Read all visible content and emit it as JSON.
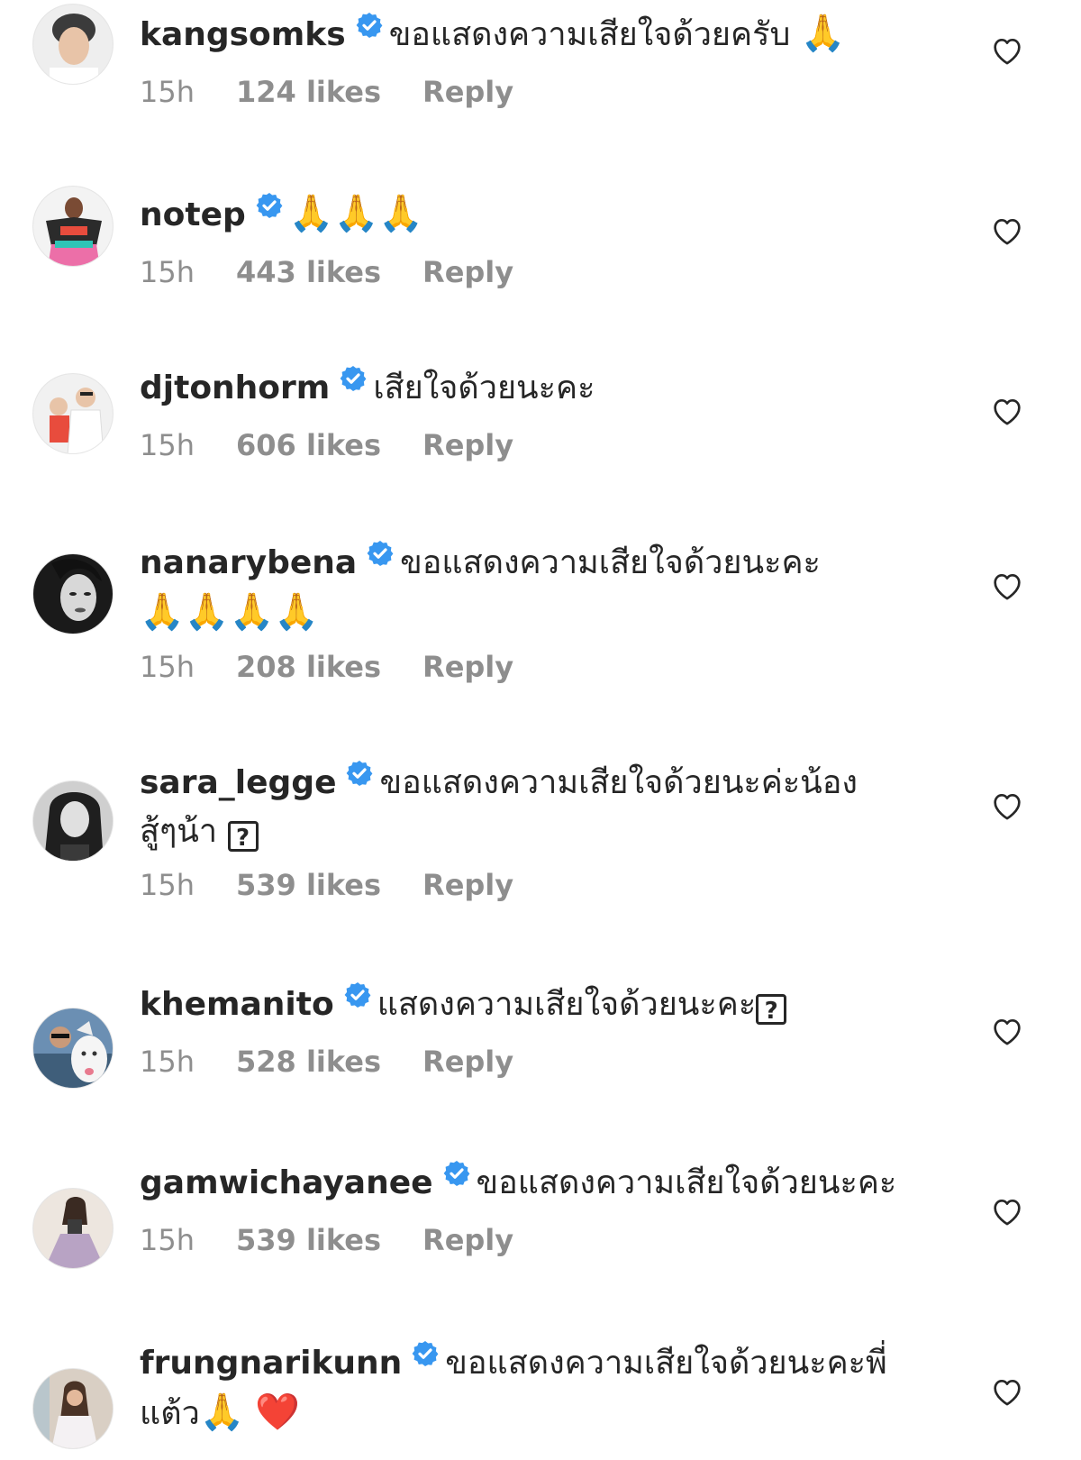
{
  "comments": [
    {
      "username": "kangsomks",
      "text": "ขอแสดงความเสียใจด้วยครับ",
      "emoji": "🙏",
      "time": "15h",
      "likes": "124 likes",
      "reply": "Reply"
    },
    {
      "username": "notep",
      "text": "",
      "emoji": "🙏🙏🙏",
      "time": "15h",
      "likes": "443 likes",
      "reply": "Reply"
    },
    {
      "username": "djtonhorm",
      "text": "เสียใจด้วยนะคะ",
      "time": "15h",
      "likes": "606 likes",
      "reply": "Reply"
    },
    {
      "username": "nanarybena",
      "text": "ขอแสดงความเสียใจด้วยนะคะ",
      "emoji": "🙏🙏🙏🙏",
      "time": "15h",
      "likes": "208 likes",
      "reply": "Reply"
    },
    {
      "username": "sara_legge",
      "text": "ขอแสดงความเสียใจด้วยนะค่ะน้อง",
      "text2": "สู้ๆน้า",
      "glyph": "?",
      "time": "15h",
      "likes": "539 likes",
      "reply": "Reply"
    },
    {
      "username": "khemanito",
      "text": "แสดงความเสียใจด้วยนะคะ",
      "glyph": "?",
      "time": "15h",
      "likes": "528 likes",
      "reply": "Reply"
    },
    {
      "username": "gamwichayanee",
      "text": "ขอแสดงความเสียใจด้วยนะคะ",
      "time": "15h",
      "likes": "539 likes",
      "reply": "Reply"
    },
    {
      "username": "frungnarikunn",
      "text": "ขอแสดงความเสียใจด้วยนะคะพี่",
      "text2": "แต้ว",
      "emoji": "🙏",
      "emoji2": "❤️"
    }
  ],
  "icons": {
    "verified": "verified-badge-icon",
    "like": "heart-outline-icon"
  },
  "colors": {
    "verified": "#3897f0",
    "meta_text": "#8e8e8e",
    "body_text": "#262626",
    "heart_outline": "#262626",
    "heart_emoji": "#e0245e"
  }
}
